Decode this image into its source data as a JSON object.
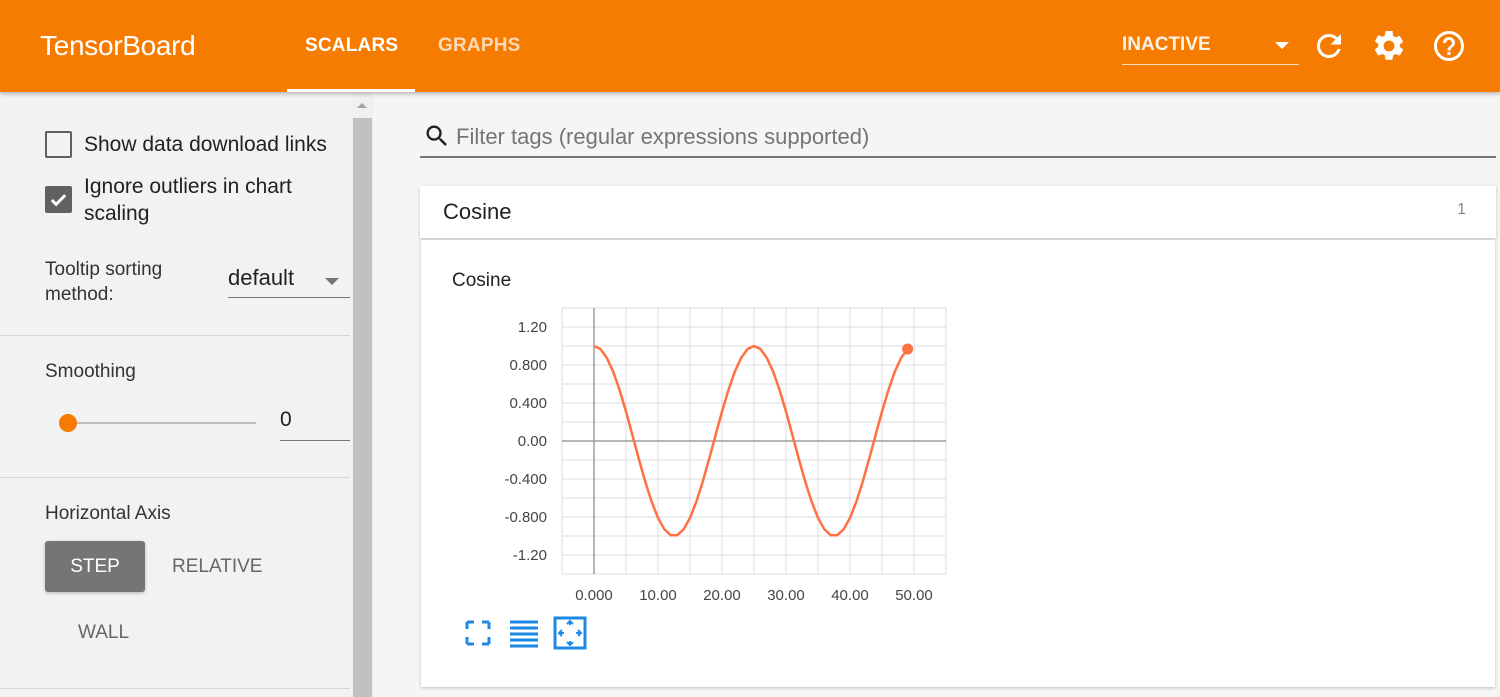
{
  "app": {
    "title": "TensorBoard",
    "tabs": [
      {
        "label": "SCALARS",
        "active": true
      },
      {
        "label": "GRAPHS",
        "active": false
      }
    ],
    "status": "INACTIVE",
    "icons": [
      "refresh-icon",
      "settings-icon",
      "help-icon"
    ]
  },
  "sidebar": {
    "show_download_links": {
      "label": "Show data download links",
      "checked": false
    },
    "ignore_outliers": {
      "label_line1": "Ignore outliers in chart",
      "label_line2": "scaling",
      "checked": true
    },
    "tooltip_sorting": {
      "label_line1": "Tooltip sorting",
      "label_line2": "method:",
      "value": "default"
    },
    "smoothing": {
      "label": "Smoothing",
      "value": "0",
      "level": 0
    },
    "horizontal_axis": {
      "label": "Horizontal Axis",
      "options": [
        "STEP",
        "RELATIVE",
        "WALL"
      ],
      "selected": "STEP"
    }
  },
  "main": {
    "filter_placeholder": "Filter tags (regular expressions supported)",
    "card": {
      "title": "Cosine",
      "count": "1"
    }
  },
  "chart_data": {
    "type": "line",
    "title": "Cosine",
    "xlabel": "",
    "ylabel": "",
    "xlim": [
      -5,
      55
    ],
    "ylim": [
      -1.4,
      1.4
    ],
    "x_ticks": [
      "0.000",
      "10.00",
      "20.00",
      "30.00",
      "40.00",
      "50.00"
    ],
    "y_ticks": [
      "1.20",
      "0.800",
      "0.400",
      "0.00",
      "-0.400",
      "-0.800",
      "-1.20"
    ],
    "grid": true,
    "line_color": "#ff7043",
    "series": [
      {
        "x": [
          0,
          1,
          2,
          3,
          4,
          5,
          6,
          7,
          8,
          9,
          10,
          11,
          12,
          13,
          14,
          15,
          16,
          17,
          18,
          19,
          20,
          21,
          22,
          23,
          24,
          25,
          26,
          27,
          28,
          29,
          30,
          31,
          32,
          33,
          34,
          35,
          36,
          37,
          38,
          39,
          40,
          41,
          42,
          43,
          44,
          45,
          46,
          47,
          48,
          49
        ],
        "values": [
          1.0,
          0.968,
          0.876,
          0.729,
          0.536,
          0.309,
          0.063,
          -0.187,
          -0.426,
          -0.637,
          -0.809,
          -0.929,
          -0.992,
          -0.992,
          -0.929,
          -0.809,
          -0.637,
          -0.426,
          -0.187,
          0.063,
          0.309,
          0.536,
          0.729,
          0.876,
          0.968,
          1.0,
          0.968,
          0.876,
          0.729,
          0.536,
          0.309,
          0.063,
          -0.187,
          -0.426,
          -0.637,
          -0.809,
          -0.929,
          -0.992,
          -0.992,
          -0.929,
          -0.809,
          -0.637,
          -0.426,
          -0.187,
          0.063,
          0.309,
          0.536,
          0.729,
          0.876,
          0.968
        ]
      }
    ]
  }
}
